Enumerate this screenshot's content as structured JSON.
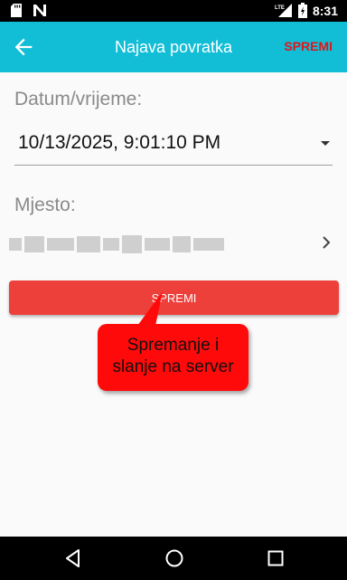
{
  "status_bar": {
    "time": "8:31",
    "network": "LTE",
    "icons": [
      "sd-card-icon",
      "n-icon",
      "signal-icon",
      "battery-icon"
    ]
  },
  "app_bar": {
    "title": "Najava povratka",
    "action_label": "SPREMI",
    "back_icon": "arrow-left-icon",
    "background": "#12bdd6",
    "action_color": "#e0161b"
  },
  "form": {
    "datetime_label": "Datum/vrijeme:",
    "datetime_value": "10/13/2025, 9:01:10 PM",
    "place_label": "Mjesto:"
  },
  "save_button": {
    "label": "SPREMI",
    "color": "#ee403b"
  },
  "callout": {
    "line1": "Spremanje i",
    "line2": "slanje na server",
    "color": "#ff0a0a"
  },
  "nav_bar": {
    "icons": [
      "back-triangle-icon",
      "home-circle-icon",
      "recents-square-icon"
    ]
  }
}
